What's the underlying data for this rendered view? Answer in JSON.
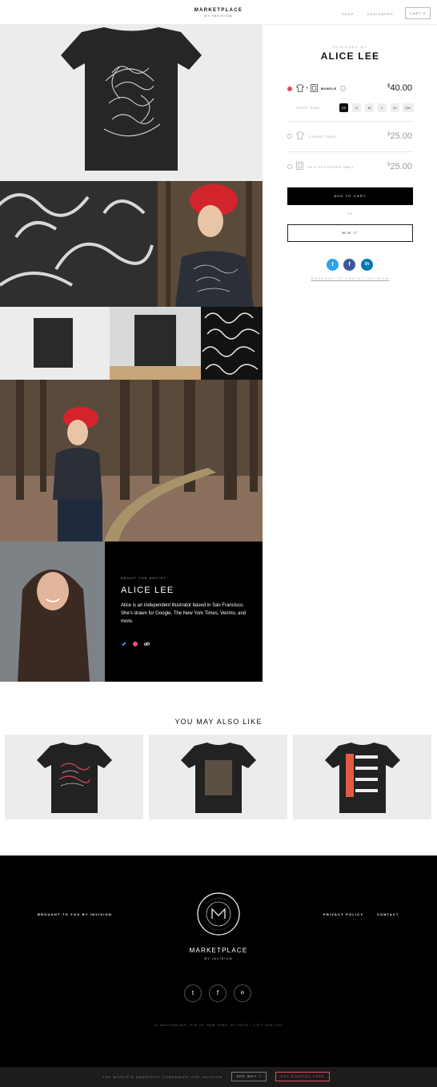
{
  "header": {
    "brand_title": "MARKETPLACE",
    "brand_sub": "BY INVISION",
    "nav_shop": "SHOP",
    "nav_designers": "DESIGNERS",
    "cart": "CART 0"
  },
  "product": {
    "designed_by_label": "DESIGNED BY",
    "designer_name": "ALICE LEE",
    "bundle_label": "BUNDLE",
    "bundle_price": "40.00",
    "shirt_size_label": "SHIRT SIZE:",
    "sizes": [
      "XS",
      "S",
      "M",
      "L",
      "XL",
      "XXL"
    ],
    "selected_size": "XS",
    "tshirt_label": "T-SHIRT ONLY",
    "tshirt_price": "25.00",
    "poster_label": "18 X 24 POSTER ONLY",
    "poster_price": "25.00",
    "currency": "$",
    "add_to_cart": "ADD TO CART",
    "or_separator": "OR",
    "win_it": "WIN IT",
    "brought_by": "BROUGHT TO YOU BY INVISION"
  },
  "artist": {
    "about_label": "ABOUT THE ARTIST",
    "name": "ALICE LEE",
    "bio": "Alice is an independent illustrator based in San Francisco. She's drawn for Google, The New York Times, Venmo, and more."
  },
  "also_like": {
    "title": "YOU MAY ALSO LIKE"
  },
  "footer": {
    "brought_by": "BROUGHT TO YOU BY INVISION",
    "privacy": "PRIVACY POLICY",
    "contact": "CONTACT",
    "brand_title": "MARKETPLACE",
    "brand_sub": "BY INVISION",
    "seal_text": "FOR DESIGNERS BY DESIGNERS",
    "address": "41 MADISON AVE, FLR 25, NEW YORK, NY 10010  |  1-877-928-7111"
  },
  "bottom_bar": {
    "text": "THE WORLD'S SMARTEST COMPANIES USE INVISION",
    "see_why": "SEE WHY +",
    "get_started": "GET STARTED FREE"
  },
  "colors": {
    "accent_red": "#e8495c",
    "twitter": "#2aa3ef",
    "facebook": "#3b5998",
    "linkedin": "#0077b5"
  },
  "icons": [
    "tshirt-icon",
    "poster-icon",
    "info-icon",
    "twitter-icon",
    "facebook-icon",
    "linkedin-icon",
    "dribbble-icon",
    "link-icon"
  ]
}
